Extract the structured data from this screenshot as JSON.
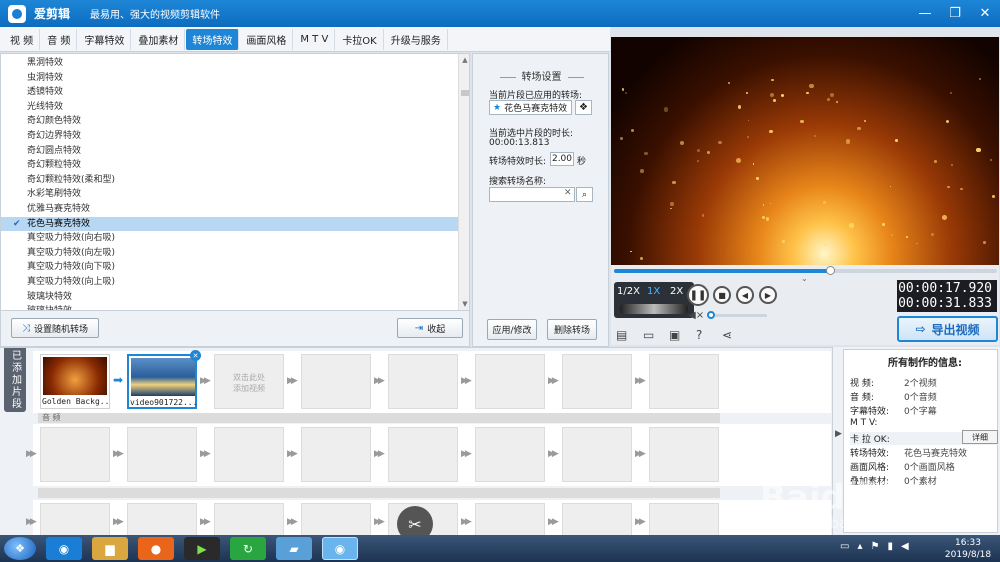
{
  "app": {
    "title": "爱剪辑",
    "slogan": "最易用、强大的视频剪辑软件"
  },
  "window_controls": [
    "—",
    "❐",
    "✕"
  ],
  "tabs": [
    {
      "label": "视  频",
      "active": false
    },
    {
      "label": "音  频",
      "active": false
    },
    {
      "label": "字幕特效",
      "active": false
    },
    {
      "label": "叠加素材",
      "active": false
    },
    {
      "label": "转场特效",
      "active": true
    },
    {
      "label": "画面风格",
      "active": false
    },
    {
      "label": "M T V",
      "active": false
    },
    {
      "label": "卡拉OK",
      "active": false
    },
    {
      "label": "升级与服务",
      "active": false
    }
  ],
  "transition_list": {
    "items": [
      "黑洞特效",
      "虫洞特效",
      "透镜特效",
      "光线特效",
      "奇幻颜色特效",
      "奇幻边界特效",
      "奇幻圆点特效",
      "奇幻颗粒特效",
      "奇幻颗粒特效(柔和型)",
      "水彩笔刷特效",
      "优雅马赛克特效",
      "花色马赛克特效",
      "真空吸力特效(向右吸)",
      "真空吸力特效(向左吸)",
      "真空吸力特效(向下吸)",
      "真空吸力特效(向上吸)",
      "玻璃块特效",
      "玻璃块特效"
    ],
    "selected_index": 11,
    "random_button": "设置随机转场",
    "favorite_button": "收起"
  },
  "settings": {
    "title": "转场设置",
    "applied_label": "当前片段已应用的转场:",
    "applied_value": "花色马赛克特效",
    "duration_label": "当前选中片段的时长:",
    "duration_value": "00:00:13.813",
    "effect_duration_label": "转场特效时长:",
    "effect_duration_value": "2.00",
    "effect_duration_unit": "秒",
    "search_label": "搜索转场名称:",
    "search_value": "",
    "apply_button": "应用/修改",
    "delete_button": "删除转场"
  },
  "player": {
    "progress_fraction": 0.564,
    "speeds": [
      "1/2X",
      "1X",
      "2X"
    ],
    "active_speed": "1X",
    "current_time": "00:00:17.920",
    "total_time": "00:00:31.833",
    "volume_fraction": 0.03,
    "export_label": "导出视频"
  },
  "timeline": {
    "side_tab": "已添加片段",
    "clips": [
      {
        "label": "Golden Backg..."
      },
      {
        "label": "video901722...."
      }
    ],
    "placeholder": "双击此处\n添加视频",
    "audio_label": "音 频"
  },
  "info_panel": {
    "title": "所有制作的信息:",
    "rows": [
      {
        "key": "视    频:",
        "value": "2个视频"
      },
      {
        "key": "音    频:",
        "value": "0个音频"
      },
      {
        "key": "字幕特效:",
        "value": "0个字幕"
      },
      {
        "key": "M  T  V:",
        "value": ""
      },
      {
        "key": "卡  拉 OK:",
        "value": ""
      },
      {
        "key": "转场特效:",
        "value": "花色马赛克特效"
      },
      {
        "key": "画面风格:",
        "value": "0个画面风格"
      },
      {
        "key": "叠加素材:",
        "value": "0个素材"
      }
    ],
    "detail_button": "详细"
  },
  "taskbar": {
    "time": "16:33",
    "date": "2019/8/18"
  },
  "watermark": {
    "main": "Baid经验",
    "sub": "jingyan.baidu.com"
  },
  "colors": {
    "accent": "#1e86d6",
    "titlebar": "#0d6cc0",
    "selection": "#b8d7f3"
  }
}
